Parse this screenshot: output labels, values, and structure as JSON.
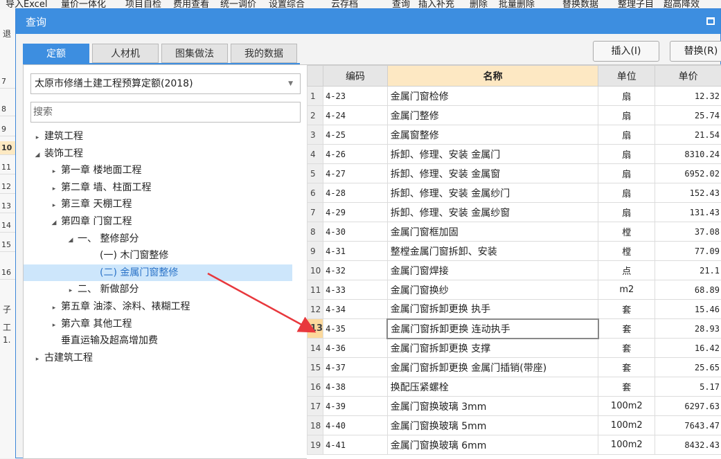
{
  "background": {
    "toolbar_items": [
      "导入Excel",
      "量价一体化",
      "项目自检",
      "费用查看",
      "统一调价",
      "设置综合",
      "云存档",
      "查询",
      "插入",
      "补充",
      "删除",
      "批量删除",
      "替换数据",
      "整理子目",
      "超高降效"
    ],
    "row_numbers": [
      "7",
      "8",
      "9",
      "10",
      "11",
      "12",
      "13",
      "14",
      "15",
      "16"
    ],
    "side_labels": [
      "退",
      "子",
      "工",
      "1."
    ]
  },
  "dialog": {
    "title": "查询",
    "tabs": [
      "定额",
      "人材机",
      "图集做法",
      "我的数据"
    ],
    "insert_button": "插入(I)",
    "replace_button": "替换(R)",
    "combo_value": "太原市修缮土建工程预算定额(2018)",
    "search_placeholder": "搜索",
    "tree": [
      {
        "label": "建筑工程",
        "toggle": "▸"
      },
      {
        "label": "装饰工程",
        "toggle": "◢"
      },
      {
        "label": "第一章 楼地面工程",
        "toggle": "▸"
      },
      {
        "label": "第二章 墙、柱面工程",
        "toggle": "▸"
      },
      {
        "label": "第三章 天棚工程",
        "toggle": "▸"
      },
      {
        "label": "第四章 门窗工程",
        "toggle": "◢"
      },
      {
        "label": "一、 整修部分",
        "toggle": "◢"
      },
      {
        "label": "(一) 木门窗整修",
        "toggle": ""
      },
      {
        "label": "(二) 金属门窗整修",
        "toggle": ""
      },
      {
        "label": "二、 新做部分",
        "toggle": "▸"
      },
      {
        "label": "第五章 油漆、涂料、裱糊工程",
        "toggle": "▸"
      },
      {
        "label": "第六章 其他工程",
        "toggle": "▸"
      },
      {
        "label": "垂直运输及超高增加费",
        "toggle": ""
      },
      {
        "label": "古建筑工程",
        "toggle": "▸"
      }
    ],
    "grid": {
      "headers": [
        "",
        "编码",
        "名称",
        "单位",
        "单价"
      ],
      "rows": [
        {
          "no": "1",
          "code": "4-23",
          "name": "金属门窗检修",
          "unit": "扇",
          "price": "12.32"
        },
        {
          "no": "2",
          "code": "4-24",
          "name": "金属门整修",
          "unit": "扇",
          "price": "25.74"
        },
        {
          "no": "3",
          "code": "4-25",
          "name": "金属窗整修",
          "unit": "扇",
          "price": "21.54"
        },
        {
          "no": "4",
          "code": "4-26",
          "name": "拆卸、修理、安装 金属门",
          "unit": "扇",
          "price": "8310.24"
        },
        {
          "no": "5",
          "code": "4-27",
          "name": "拆卸、修理、安装 金属窗",
          "unit": "扇",
          "price": "6952.02"
        },
        {
          "no": "6",
          "code": "4-28",
          "name": "拆卸、修理、安装 金属纱门",
          "unit": "扇",
          "price": "152.43"
        },
        {
          "no": "7",
          "code": "4-29",
          "name": "拆卸、修理、安装 金属纱窗",
          "unit": "扇",
          "price": "131.43"
        },
        {
          "no": "8",
          "code": "4-30",
          "name": "金属门窗框加固",
          "unit": "樘",
          "price": "37.08"
        },
        {
          "no": "9",
          "code": "4-31",
          "name": "整樘金属门窗拆卸、安装",
          "unit": "樘",
          "price": "77.09"
        },
        {
          "no": "10",
          "code": "4-32",
          "name": "金属门窗焊接",
          "unit": "点",
          "price": "21.1"
        },
        {
          "no": "11",
          "code": "4-33",
          "name": "金属门窗换纱",
          "unit": "m2",
          "price": "68.89"
        },
        {
          "no": "12",
          "code": "4-34",
          "name": "金属门窗拆卸更换 执手",
          "unit": "套",
          "price": "15.46"
        },
        {
          "no": "13",
          "code": "4-35",
          "name": "金属门窗拆卸更换 连动执手",
          "unit": "套",
          "price": "28.93"
        },
        {
          "no": "14",
          "code": "4-36",
          "name": "金属门窗拆卸更换 支撑",
          "unit": "套",
          "price": "16.42"
        },
        {
          "no": "15",
          "code": "4-37",
          "name": "金属门窗拆卸更换 金属门插销(带座)",
          "unit": "套",
          "price": "25.65"
        },
        {
          "no": "16",
          "code": "4-38",
          "name": "换配压紧螺栓",
          "unit": "套",
          "price": "5.17"
        },
        {
          "no": "17",
          "code": "4-39",
          "name": "金属门窗换玻璃 3mm",
          "unit": "100m2",
          "price": "6297.63"
        },
        {
          "no": "18",
          "code": "4-40",
          "name": "金属门窗换玻璃 5mm",
          "unit": "100m2",
          "price": "7643.47"
        },
        {
          "no": "19",
          "code": "4-41",
          "name": "金属门窗换玻璃 6mm",
          "unit": "100m2",
          "price": "8432.43"
        }
      ]
    },
    "colors": {
      "accent": "#3d8ee0",
      "selected_tree": "#cde6fb",
      "header_name": "#fde8c3",
      "annotation_arrow": "#e8383d"
    }
  }
}
